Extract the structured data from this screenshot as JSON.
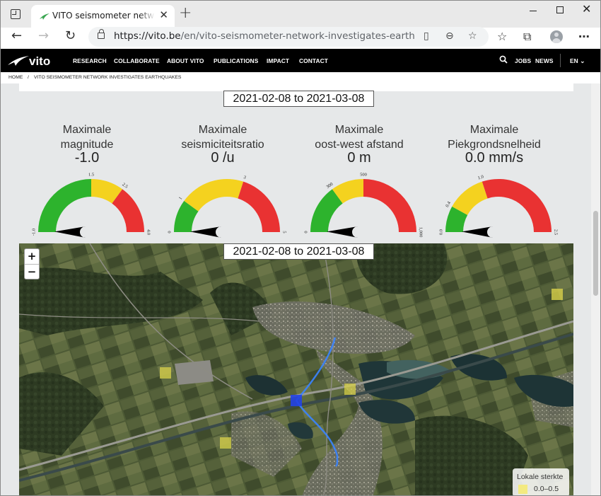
{
  "browser": {
    "tab_title": "VITO seismometer network investigates earthquakes",
    "url_host": "https://vito.be",
    "url_path": "/en/vito-seismometer-network-investigates-earthqua..."
  },
  "site": {
    "logo": "vito",
    "nav": [
      "RESEARCH",
      "COLLABORATE",
      "ABOUT VITO",
      "PUBLICATIONS",
      "IMPACT",
      "CONTACT"
    ],
    "jobs": "JOBS",
    "news": "NEWS",
    "lang": "EN",
    "breadcrumb": [
      "HOME",
      "/",
      "VITO SEISMOMETER NETWORK INVESTIGATES EARTHQUAKES"
    ]
  },
  "date_range": "2021-02-08 to 2021-03-08",
  "map_date_range": "2021-02-08 to 2021-03-08",
  "gauges": [
    {
      "title_line1": "Maximale",
      "title_line2": "magnitude",
      "value": "-1.0",
      "num": -1.0,
      "min": -1.0,
      "max": 4.0,
      "bands": [
        1.5,
        2.5
      ],
      "ticks": [
        {
          "v": -1.0,
          "label": "-1.0"
        },
        {
          "v": 1.5,
          "label": "1.5"
        },
        {
          "v": 2.5,
          "label": "2.5"
        },
        {
          "v": 4.0,
          "label": "4.0"
        }
      ]
    },
    {
      "title_line1": "Maximale",
      "title_line2": "seismiciteitsratio",
      "value": "0 /u",
      "num": 0,
      "min": 0,
      "max": 5,
      "bands": [
        1,
        3
      ],
      "ticks": [
        {
          "v": 0,
          "label": "0"
        },
        {
          "v": 1,
          "label": "1"
        },
        {
          "v": 3,
          "label": "3"
        },
        {
          "v": 5,
          "label": "5"
        }
      ]
    },
    {
      "title_line1": "Maximale",
      "title_line2": "oost-west afstand",
      "value": "0 m",
      "num": 0,
      "min": 0,
      "max": 1000,
      "bands": [
        300,
        500
      ],
      "ticks": [
        {
          "v": 0,
          "label": "0"
        },
        {
          "v": 300,
          "label": "300"
        },
        {
          "v": 500,
          "label": "500"
        },
        {
          "v": 1000,
          "label": "1,000"
        }
      ]
    },
    {
      "title_line1": "Maximale",
      "title_line2": "Piekgrondsnelheid",
      "value": "0.0 mm/s",
      "num": 0.0,
      "min": 0.0,
      "max": 2.5,
      "bands": [
        0.4,
        1.0
      ],
      "ticks": [
        {
          "v": 0.0,
          "label": "0.0"
        },
        {
          "v": 0.4,
          "label": "0.4"
        },
        {
          "v": 1.0,
          "label": "1.0"
        },
        {
          "v": 2.5,
          "label": "2.5"
        }
      ]
    }
  ],
  "gauge_colors": {
    "green": "#2db32d",
    "yellow": "#f4d21f",
    "red": "#e93232"
  },
  "map": {
    "zoom_in": "+",
    "zoom_out": "−",
    "legend_title": "Lokale sterkte",
    "legend_range": "0.0–0.5"
  }
}
